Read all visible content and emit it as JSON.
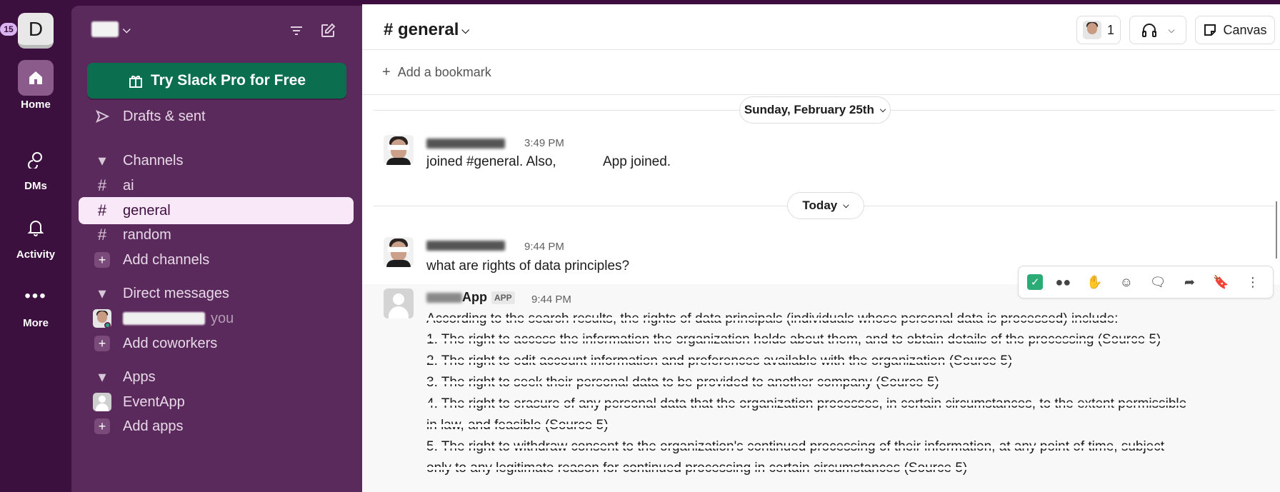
{
  "rail": {
    "badge": "15",
    "workspace_initial": "D",
    "items": [
      {
        "label": "Home",
        "icon": "home-icon"
      },
      {
        "label": "DMs",
        "icon": "dms-icon"
      },
      {
        "label": "Activity",
        "icon": "bell-icon"
      },
      {
        "label": "More",
        "icon": "more-icon"
      }
    ]
  },
  "sidebar": {
    "try_pro": "Try Slack Pro for Free",
    "drafts": "Drafts & sent",
    "channels_header": "Channels",
    "channels": [
      "ai",
      "general",
      "random"
    ],
    "add_channels": "Add channels",
    "dm_header": "Direct messages",
    "dm_you": "you",
    "add_coworkers": "Add coworkers",
    "apps_header": "Apps",
    "apps": [
      "EventApp"
    ],
    "add_apps": "Add apps"
  },
  "header": {
    "channel": "# general",
    "member_count": "1",
    "canvas": "Canvas",
    "bookmark": "Add a bookmark"
  },
  "dates": {
    "first": "Sunday, February 25th",
    "second": "Today"
  },
  "messages": [
    {
      "time": "3:49 PM",
      "text": "joined #general. Also, ",
      "text_suffix": "App joined."
    },
    {
      "time": "9:44 PM",
      "text": "what are rights of data principles?"
    },
    {
      "name": "App",
      "tag": "APP",
      "time": "9:44 PM",
      "lines": [
        "According to the search results, the rights of data principals (individuals whose personal data is processed) include:",
        "1. The right to access the information the organization holds about them, and to obtain details of the processing (Source 5)",
        "2. The right to edit account information and preferences available with the organization (Source 5)",
        "3. The right to seek their personal data to be provided to another company (Source 5)",
        "4. The right to erasure of any personal data that the organization processes, in certain circumstances, to the extent permissible",
        "in law, and feasible (Source 5)",
        "5. The right to withdraw consent to the organization's continued processing of their information, at any point of time, subject",
        "only to any legitimate reason for continued processing in certain circumstances (Source 5)"
      ]
    }
  ],
  "colors": {
    "rail": "#3b0f3e",
    "sidebar": "#5b2a5c",
    "try_pro": "#0b6e4f",
    "active_row": "#f8e8f8"
  }
}
